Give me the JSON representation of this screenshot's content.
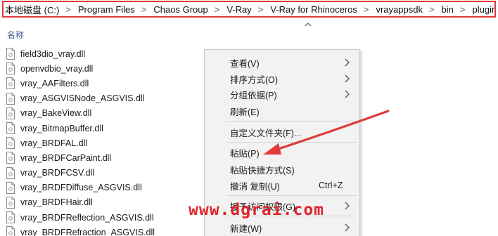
{
  "breadcrumb": [
    "本地磁盘 (C:)",
    "Program Files",
    "Chaos Group",
    "V-Ray",
    "V-Ray for Rhinoceros",
    "vrayappsdk",
    "bin",
    "plugins"
  ],
  "column_header": {
    "name_label": "名称"
  },
  "files": [
    "field3dio_vray.dll",
    "openvdbio_vray.dll",
    "vray_AAFilters.dll",
    "vray_ASGVISNode_ASGVIS.dll",
    "vray_BakeView.dll",
    "vray_BitmapBuffer.dll",
    "vray_BRDFAL.dll",
    "vray_BRDFCarPaint.dll",
    "vray_BRDFCSV.dll",
    "vray_BRDFDiffuse_ASGVIS.dll",
    "vray_BRDFHair.dll",
    "vray_BRDFReflection_ASGVIS.dll",
    "vray_BRDFRefraction_ASGVIS.dll"
  ],
  "context_menu": {
    "view": "查看(V)",
    "sort_by": "排序方式(O)",
    "group_by": "分组依据(P)",
    "refresh": "刷新(E)",
    "customize_folder": "自定义文件夹(F)...",
    "paste": "粘贴(P)",
    "paste_shortcut": "粘贴快捷方式(S)",
    "undo_copy": "撤消 复制(U)",
    "undo_copy_shortcut": "Ctrl+Z",
    "grant_access": "授予访问权限(G)",
    "new": "新建(W)"
  },
  "watermark": {
    "text": "www.dgrai.com"
  },
  "colors": {
    "highlight_border": "#e03a3a",
    "annotation_arrow": "#e23a3a",
    "watermark": "#e0232a"
  }
}
